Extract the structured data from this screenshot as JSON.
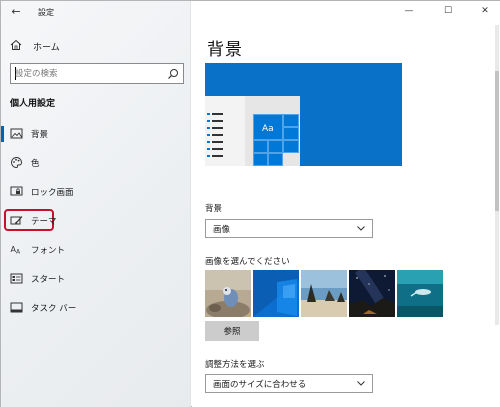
{
  "titlebar": {
    "back_icon": "back-arrow-icon",
    "title": "設定",
    "minimize": "—",
    "maximize": "☐",
    "close": "✕"
  },
  "sidebar": {
    "home": {
      "label": "ホーム",
      "icon": "home-icon"
    },
    "search": {
      "placeholder": "設定の検索",
      "icon": "search-icon"
    },
    "section_heading": "個人用設定",
    "items": [
      {
        "label": "背景",
        "icon": "picture-icon",
        "selected": true
      },
      {
        "label": "色",
        "icon": "palette-icon",
        "selected": false
      },
      {
        "label": "ロック画面",
        "icon": "lock-screen-icon",
        "selected": false
      },
      {
        "label": "テーマ",
        "icon": "theme-brush-icon",
        "selected": false,
        "highlighted": true
      },
      {
        "label": "フォント",
        "icon": "font-icon",
        "selected": false
      },
      {
        "label": "スタート",
        "icon": "start-menu-icon",
        "selected": false
      },
      {
        "label": "タスク バー",
        "icon": "taskbar-icon",
        "selected": false
      }
    ]
  },
  "main": {
    "title": "背景",
    "preview_text": "Aa",
    "background_label": "背景",
    "background_value": "画像",
    "choose_image_label": "画像を選んでください",
    "browse_label": "参照",
    "fit_label": "調整方法を選ぶ",
    "fit_value": "画面のサイズに合わせる"
  },
  "colors": {
    "accent": "#0078d7",
    "selection_bar": "#0063b1",
    "highlight_border": "#c8102e",
    "preview_bg": "#0a71c9"
  }
}
